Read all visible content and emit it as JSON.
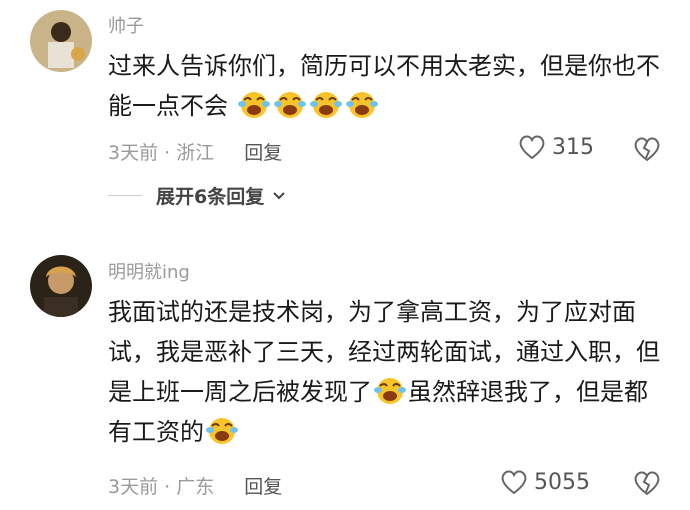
{
  "comments": [
    {
      "username": "帅子",
      "text": "过来人告诉你们，简历可以不用太老实，但是你也不能一点不会",
      "emoji_count": 4,
      "time_location": "3天前 · 浙江",
      "reply_label": "回复",
      "likes": "315",
      "expand_label": "展开6条回复"
    },
    {
      "username": "明明就ing",
      "text_part1": "我面试的还是技术岗，为了拿高工资，为了应对面试，我是恶补了三天，经过两轮面试，通过入职，但是上班一周之后被发现了",
      "text_part2": "虽然辞退我了，但是都有工资的",
      "time_location": "3天前 · 广东",
      "reply_label": "回复",
      "likes": "5055"
    }
  ],
  "colors": {
    "text": "#1a1a1a",
    "muted": "#9a9a9a",
    "emoji": "#f7c52b"
  },
  "icons": [
    "heart-icon",
    "dislike-heart-icon",
    "chevron-down-icon",
    "laughing-crying-emoji",
    "avatar"
  ]
}
